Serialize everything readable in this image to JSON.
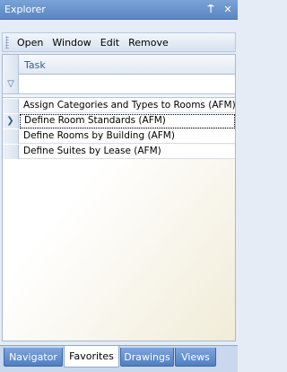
{
  "window": {
    "title": "Explorer",
    "pin_glyph": "⍑",
    "close_glyph": "✕"
  },
  "menu": {
    "items": [
      "Open",
      "Window",
      "Edit",
      "Remove"
    ]
  },
  "grid": {
    "column_header": "Task",
    "filter_value": "",
    "rows": [
      {
        "task": "Assign Categories and Types to Rooms (AFM)",
        "selected": false
      },
      {
        "task": "Define Room Standards (AFM)",
        "selected": true
      },
      {
        "task": "Define Rooms by Building (AFM)",
        "selected": false
      },
      {
        "task": "Define Suites by Lease (AFM)",
        "selected": false
      }
    ],
    "current_row_glyph": "❯",
    "filter_glyph": "▽"
  },
  "tabs": {
    "items": [
      "Navigator",
      "Favorites",
      "Drawings",
      "Views"
    ],
    "active": "Favorites"
  }
}
